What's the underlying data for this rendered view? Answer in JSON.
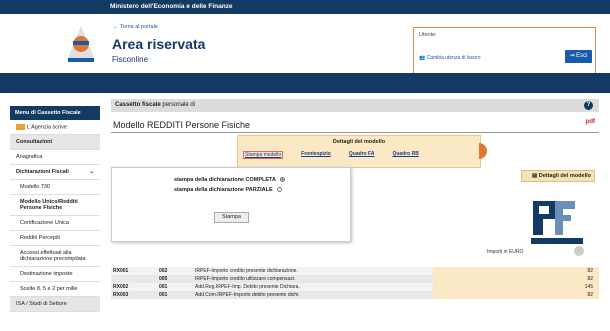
{
  "topbar": {
    "title": "Ministero dell'Economia e delle Finanze"
  },
  "header": {
    "back_link": "Torna al portale",
    "area_title": "Area riservata",
    "area_sub": "Fisconline"
  },
  "userbox": {
    "label": "Utente:",
    "change_link": "Cambia utenza di lavoro",
    "exit_label": "Esci"
  },
  "sidebar": {
    "head": "Menu di Cassetto Fiscale",
    "mail": "L'Agenzia scrive",
    "items": [
      "Consultazioni",
      "Anagrafica",
      "Dichiarazioni Fiscali",
      "Modello 730",
      "Modello Unico/Redditi Persone Fisiche",
      "Certificazione Unica",
      "Redditi Percepiti",
      "Accessi effettuati alla dichiarazione precompilata",
      "Destinazione imposte",
      "Scelte 8, 5 e 2 per mille",
      "ISA / Studi di Settore"
    ]
  },
  "main": {
    "cassetto_bold": "Cassetto fiscale",
    "cassetto_rest": " personale di",
    "model_title": "Modello REDDITI Persone Fisiche",
    "pdf_label": "pdf",
    "details_title": "Dettagli del modello",
    "tabs": [
      "Stampa modello",
      "Frontespizio",
      "Quadro FA",
      "Quadro RB"
    ],
    "details_button": "Dettagli del modello",
    "print_complete": "stampa della dichiarazione COMPLETA",
    "print_partial": "stampa della dichiarazione PARZIALE",
    "print_button": "Stampa",
    "importo_label": "Importi in EURO",
    "rows": [
      {
        "code": "RX001",
        "col": "002",
        "desc": "IRPEF-Importo credito presente dichiarazione.",
        "amount": "82"
      },
      {
        "code": "",
        "col": "005",
        "desc": "IRPEF-Importo credito utilizzare compensazi.",
        "amount": "82"
      },
      {
        "code": "RX002",
        "col": "001",
        "desc": "Add.Reg.IRPEF-Imp. Debito presente Dichiara.",
        "amount": "145"
      },
      {
        "code": "RX003",
        "col": "001",
        "desc": "Add.Com.IRPEF-Importo debito presente dichi.",
        "amount": "82"
      }
    ]
  },
  "colors": {
    "navy": "#123a63",
    "accent_orange": "#e07830",
    "link_blue": "#1a5aa8"
  }
}
